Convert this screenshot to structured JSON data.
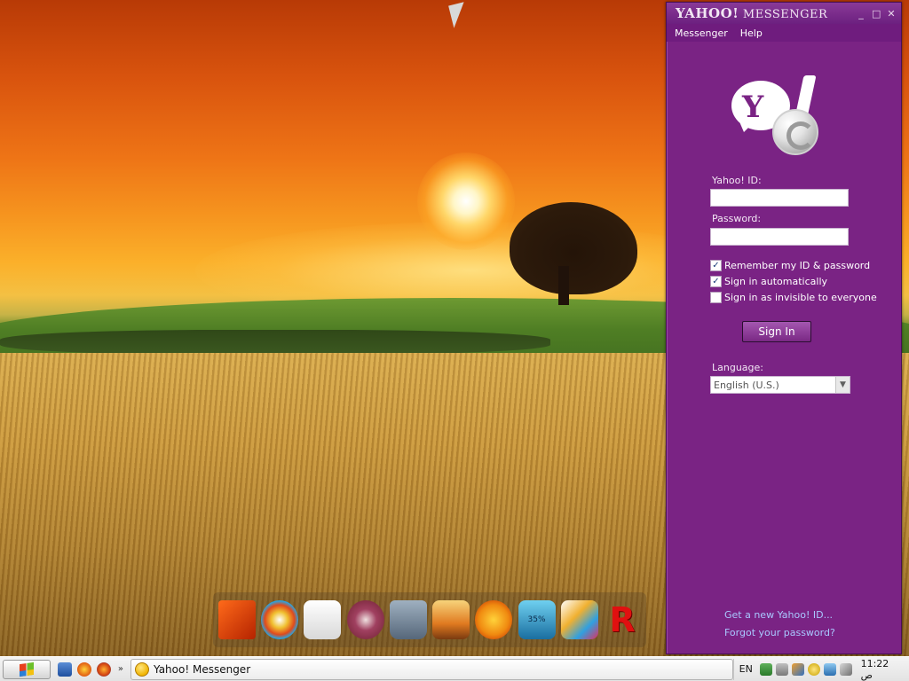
{
  "desktop": {
    "dock_icons": [
      "media-player-icon",
      "windows-logo-icon",
      "removable-drive-icon",
      "disc-icon",
      "recycle-bin-icon",
      "picture-frame-icon",
      "internet-explorer-icon",
      "speed-gauge-icon",
      "paint-palette-icon",
      "r-letter-icon"
    ],
    "dock_gauge_text": "35%"
  },
  "messenger": {
    "title_brand": "YAHOO!",
    "title_text": "MESSENGER",
    "window_buttons": [
      "_",
      "□",
      "✕"
    ],
    "menu": [
      "Messenger",
      "Help"
    ],
    "yahoo_id_label": "Yahoo! ID:",
    "yahoo_id_value": "",
    "password_label": "Password:",
    "password_value": "",
    "options": [
      {
        "label": "Remember my ID & password",
        "checked": true
      },
      {
        "label": "Sign in automatically",
        "checked": true
      },
      {
        "label": "Sign in as invisible to everyone",
        "checked": false
      }
    ],
    "sign_in_label": "Sign In",
    "language_label": "Language:",
    "language_value": "English (U.S.)",
    "link_new_id": "Get a new Yahoo! ID...",
    "link_forgot": "Forgot your password?",
    "colors": {
      "window": "#7a2384",
      "titlebar": "#6c2080",
      "link": "#a9c8ff"
    }
  },
  "taskbar": {
    "task_label": "Yahoo! Messenger",
    "quick_launch_more": "»",
    "input_language": "EN",
    "clock": "11:22 ص"
  }
}
